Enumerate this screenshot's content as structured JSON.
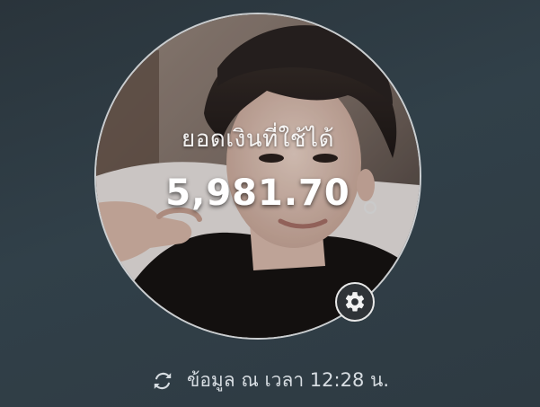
{
  "balance": {
    "label": "ยอดเงินที่ใช้ได้",
    "amount": "5,981.70"
  },
  "profile": {
    "photo": "profile-photo"
  },
  "status": {
    "updated_text": "ข้อมูล ณ เวลา 12:28 น."
  },
  "icons": {
    "settings": "gear-icon",
    "refresh": "refresh-icon"
  },
  "colors": {
    "background": "#2e3a42",
    "text_primary": "#ffffff",
    "text_secondary": "#d7dde2",
    "settings_button_bg": "#2f3337"
  }
}
